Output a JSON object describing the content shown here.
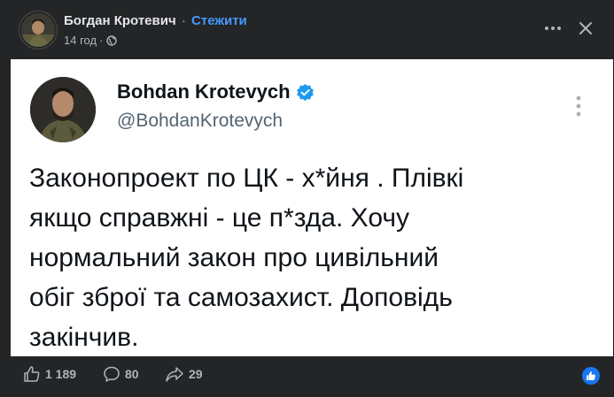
{
  "post": {
    "author": "Богдан Кротевич",
    "separator": "·",
    "follow_label": "Стежити",
    "time": "14 год",
    "meta_separator": "·",
    "audience_icon": "globe-icon",
    "more_icon": "ellipsis-icon",
    "close_icon": "close-icon"
  },
  "tweet": {
    "display_name": "Bohdan Krotevych",
    "verified_icon": "verified-badge-icon",
    "handle": "@BohdanKrotevych",
    "text": "Законопроект по ЦК - х*йня . Плівкі\nякщо справжні - це п*зда. Хочу\nнормальний закон про цивільний\nобіг зброї та самозахист. Доповідь\nзакінчив.",
    "more_icon": "vertical-dots-icon"
  },
  "footer": {
    "likes": "1 189",
    "comments": "80",
    "shares": "29",
    "like_icon": "thumbs-up-icon",
    "comment_icon": "comment-icon",
    "share_icon": "share-icon",
    "reaction_icon": "like-reaction-icon"
  },
  "colors": {
    "background": "#242526",
    "card": "#ffffff",
    "follow": "#4599ff",
    "verified": "#1d9bf0",
    "reaction": "#1877f2"
  }
}
